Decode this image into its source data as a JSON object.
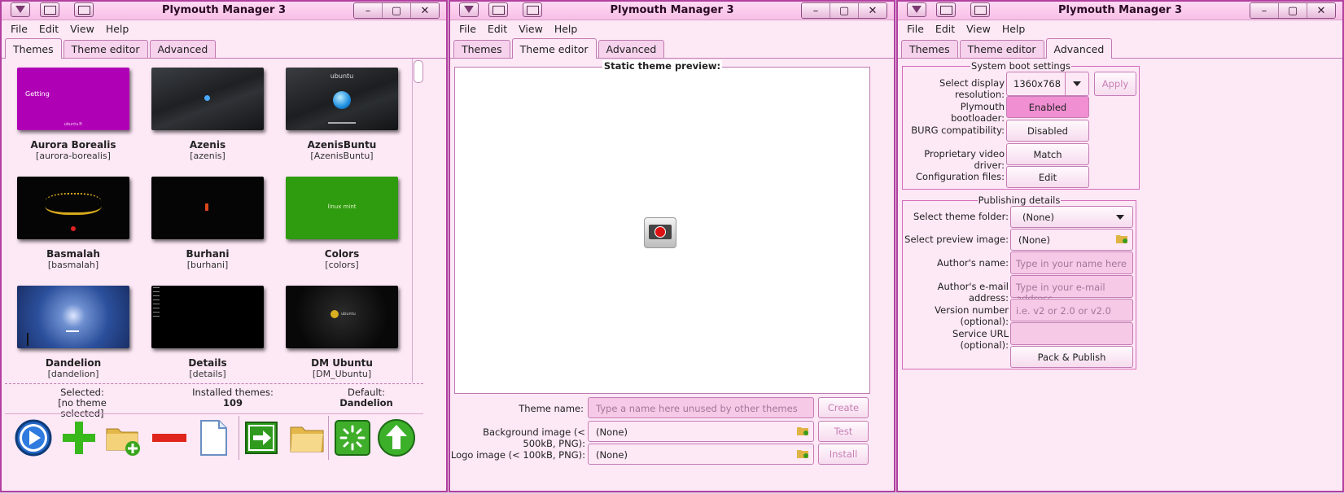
{
  "windows": [
    {
      "title": "Plymouth Manager 3"
    },
    {
      "title": "Plymouth Manager 3"
    },
    {
      "title": "Plymouth Manager 3"
    }
  ],
  "menu": [
    "File",
    "Edit",
    "View",
    "Help"
  ],
  "tabs": [
    "Themes",
    "Theme editor",
    "Advanced"
  ],
  "themes": [
    {
      "name": "Aurora Borealis",
      "id": "[aurora-borealis]",
      "thumb_text": "Getting",
      "thumb_sub": "ubuntu®"
    },
    {
      "name": "Azenis",
      "id": "[azenis]"
    },
    {
      "name": "AzenisBuntu",
      "id": "[AzenisBuntu]",
      "thumb_text": "ubuntu"
    },
    {
      "name": "Basmalah",
      "id": "[basmalah]"
    },
    {
      "name": "Burhani",
      "id": "[burhani]"
    },
    {
      "name": "Colors",
      "id": "[colors]",
      "thumb_text": "linux mint"
    },
    {
      "name": "Dandelion",
      "id": "[dandelion]"
    },
    {
      "name": "Details",
      "id": "[details]"
    },
    {
      "name": "DM Ubuntu",
      "id": "[DM_Ubuntu]",
      "thumb_text": "ubuntu"
    }
  ],
  "status": {
    "selected_label": "Selected:",
    "selected_value": "[no theme selected]",
    "installed_label": "Installed themes:",
    "installed_value": "109",
    "default_label": "Default:",
    "default_value": "Dandelion"
  },
  "toolbar_icons": [
    "play-icon",
    "add-icon",
    "folder-add-icon",
    "remove-icon",
    "document-icon",
    "export-icon",
    "folder-icon",
    "loading-icon",
    "upload-icon"
  ],
  "editor": {
    "preview_label": "Static theme preview:",
    "theme_name_label": "Theme name:",
    "theme_name_placeholder": "Type a name here unused by other themes",
    "background_label": "Background image (< 500kB, PNG):",
    "background_value": "(None)",
    "logo_label": "Logo image (< 100kB, PNG):",
    "logo_value": "(None)",
    "create": "Create",
    "test": "Test",
    "install": "Install"
  },
  "advanced": {
    "system_title": "System boot settings",
    "resolution_label": "Select display resolution:",
    "resolution_value": "1360x768",
    "apply": "Apply",
    "bootloader_label": "Plymouth bootloader:",
    "bootloader_value": "Enabled",
    "burg_label": "BURG compatibility:",
    "burg_value": "Disabled",
    "driver_label": "Proprietary video driver:",
    "driver_value": "Match",
    "config_label": "Configuration files:",
    "config_value": "Edit",
    "publish_title": "Publishing details",
    "folder_label": "Select theme folder:",
    "folder_value": "(None)",
    "preview_label": "Select preview image:",
    "preview_value": "(None)",
    "author_label": "Author's name:",
    "author_placeholder": "Type in your name here",
    "email_label": "Author's e-mail address:",
    "email_placeholder": "Type in your e-mail address",
    "version_label": "Version number (optional):",
    "version_placeholder": "i.e. v2 or 2.0 or v2.0",
    "url_label": "Service URL (optional):",
    "pack": "Pack & Publish"
  },
  "colors": {
    "accent": "#b23fa0",
    "window_bg": "#fde8f6",
    "pressed": "#f18fd3"
  }
}
